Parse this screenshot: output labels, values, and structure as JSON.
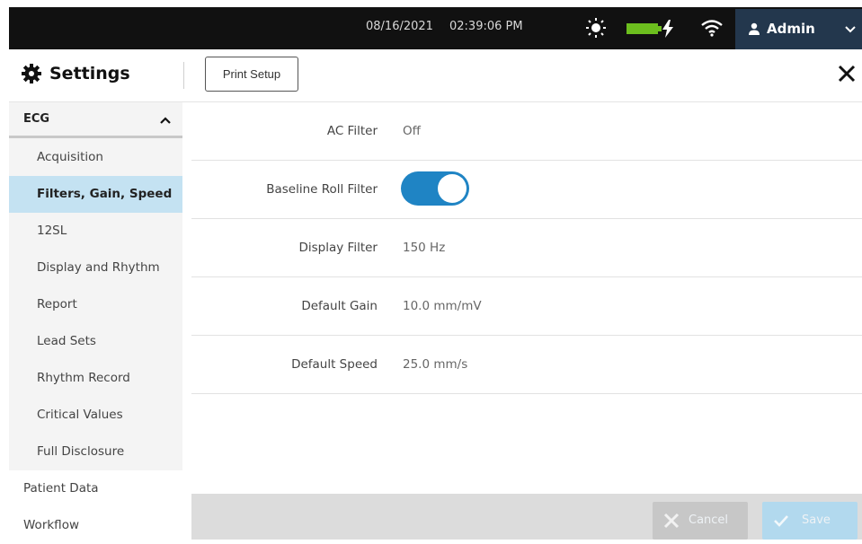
{
  "topbar": {
    "date": "08/16/2021",
    "time": "02:39:06 PM",
    "user": "Admin",
    "icons": [
      "brightness-icon",
      "battery-icon",
      "charging-icon",
      "wifi-icon",
      "user-icon",
      "chevron-down-icon"
    ],
    "battery_color": "#6cbe1e"
  },
  "header": {
    "title": "Settings",
    "print_setup": "Print Setup",
    "icons": [
      "gear-icon",
      "close-icon"
    ]
  },
  "sidebar": {
    "group": "ECG",
    "items": [
      {
        "label": "Acquisition",
        "active": false
      },
      {
        "label": "Filters, Gain, Speed",
        "active": true
      },
      {
        "label": "12SL",
        "active": false
      },
      {
        "label": "Display and Rhythm",
        "active": false
      },
      {
        "label": "Report",
        "active": false
      },
      {
        "label": "Lead Sets",
        "active": false
      },
      {
        "label": "Rhythm Record",
        "active": false
      },
      {
        "label": "Critical Values",
        "active": false
      },
      {
        "label": "Full Disclosure",
        "active": false
      }
    ],
    "top_items": [
      "Patient Data",
      "Workflow"
    ]
  },
  "settings": [
    {
      "label": "AC Filter",
      "value": "Off"
    },
    {
      "label": "Baseline Roll Filter",
      "toggle": true
    },
    {
      "label": "Display Filter",
      "value": "150 Hz"
    },
    {
      "label": "Default Gain",
      "value": "10.0 mm/mV"
    },
    {
      "label": "Default Speed",
      "value": "25.0 mm/s"
    }
  ],
  "footer": {
    "cancel": "Cancel",
    "save": "Save"
  },
  "colors": {
    "accent": "#1f84c4",
    "active_item": "#c4e2f2",
    "user_button": "#23374d"
  }
}
